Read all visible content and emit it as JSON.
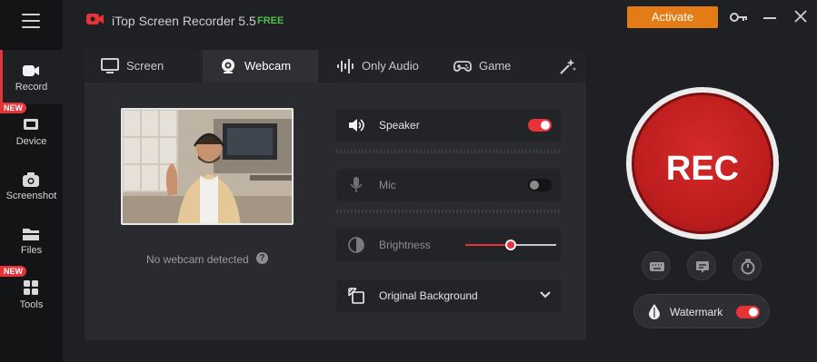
{
  "app": {
    "title": "iTop Screen Recorder 5.5",
    "edition": "FREE",
    "activate_label": "Activate",
    "accent_color": "#e73338"
  },
  "sidebar": {
    "items": [
      {
        "label": "Record",
        "icon": "record-icon",
        "active": true
      },
      {
        "label": "Device",
        "icon": "device-icon",
        "badge": "NEW"
      },
      {
        "label": "Screenshot",
        "icon": "camera-icon"
      },
      {
        "label": "Files",
        "icon": "folder-icon"
      },
      {
        "label": "Tools",
        "icon": "tools-icon",
        "badge": "NEW"
      }
    ]
  },
  "tabs": [
    {
      "label": "Screen",
      "icon": "monitor-icon"
    },
    {
      "label": "Webcam",
      "icon": "webcam-icon",
      "active": true
    },
    {
      "label": "Only Audio",
      "icon": "waveform-icon"
    },
    {
      "label": "Game",
      "icon": "gamepad-icon"
    }
  ],
  "webcam": {
    "status_text": "No webcam detected"
  },
  "settings": {
    "speaker": {
      "label": "Speaker",
      "enabled": true
    },
    "mic": {
      "label": "Mic",
      "enabled": false
    },
    "brightness": {
      "label": "Brightness",
      "level": 0.5
    },
    "background": {
      "label": "Original Background"
    }
  },
  "rec": {
    "label": "REC",
    "watermark_label": "Watermark",
    "watermark_enabled": true
  }
}
